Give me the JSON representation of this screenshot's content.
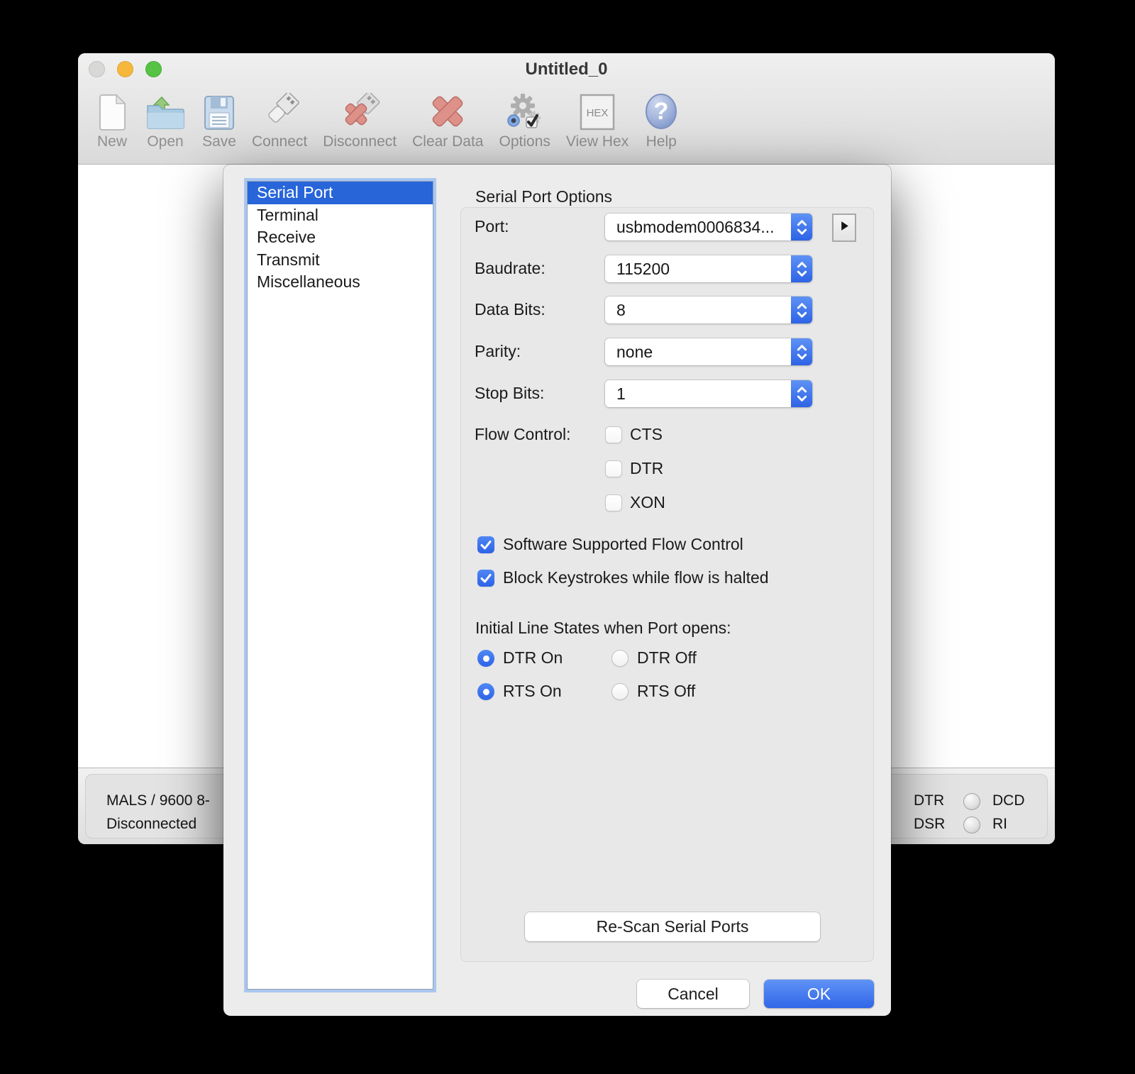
{
  "window": {
    "title": "Untitled_0",
    "toolbar": {
      "items": [
        {
          "label": "New"
        },
        {
          "label": "Open"
        },
        {
          "label": "Save"
        },
        {
          "label": "Connect"
        },
        {
          "label": "Disconnect"
        },
        {
          "label": "Clear Data"
        },
        {
          "label": "Options"
        },
        {
          "label": "View Hex"
        },
        {
          "label": "Help"
        }
      ],
      "hex_badge": "HEX",
      "help_glyph": "?"
    },
    "statusbar": {
      "left": {
        "line1": "MALS / 9600 8-",
        "line2": "Disconnected"
      },
      "right": {
        "rows": [
          {
            "label1": "DTR",
            "label2": "DCD"
          },
          {
            "label1": "DSR",
            "label2": "RI"
          }
        ]
      }
    }
  },
  "dialog": {
    "categories": [
      {
        "label": "Serial Port",
        "selected": true
      },
      {
        "label": "Terminal",
        "selected": false
      },
      {
        "label": "Receive",
        "selected": false
      },
      {
        "label": "Transmit",
        "selected": false
      },
      {
        "label": "Miscellaneous",
        "selected": false
      }
    ],
    "pane_title": "Serial Port Options",
    "fields": [
      {
        "label": "Port:",
        "value": "usbmodem0006834..."
      },
      {
        "label": "Baudrate:",
        "value": "115200"
      },
      {
        "label": "Data Bits:",
        "value": "8"
      },
      {
        "label": "Parity:",
        "value": "none"
      },
      {
        "label": "Stop Bits:",
        "value": "1"
      }
    ],
    "flow_control": {
      "label": "Flow Control:",
      "options": [
        {
          "label": "CTS",
          "checked": false
        },
        {
          "label": "DTR",
          "checked": false
        },
        {
          "label": "XON",
          "checked": false
        }
      ]
    },
    "checkboxes": [
      {
        "label": "Software Supported Flow Control",
        "checked": true
      },
      {
        "label": "Block Keystrokes while flow is halted",
        "checked": true
      }
    ],
    "initial_line_states": {
      "label": "Initial Line States when Port opens:",
      "radios": [
        {
          "label": "DTR On",
          "selected": true
        },
        {
          "label": "DTR Off",
          "selected": false
        },
        {
          "label": "RTS On",
          "selected": true
        },
        {
          "label": "RTS Off",
          "selected": false
        }
      ]
    },
    "buttons": {
      "rescan": "Re-Scan Serial Ports",
      "cancel": "Cancel",
      "ok": "OK"
    }
  },
  "colors": {
    "accent_blue": "#3166e8",
    "selection_blue": "#2765d9",
    "focus_ring": "#a9c7ef",
    "dialog_bg": "#ececec",
    "traffic_yellow": "#f5b83d",
    "traffic_green": "#56c344",
    "clear_red": "#dd9188"
  }
}
